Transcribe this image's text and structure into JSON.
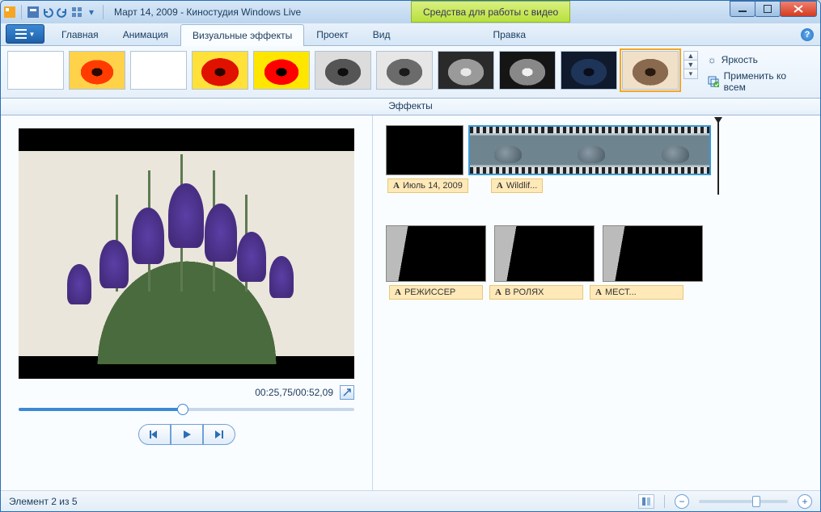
{
  "titlebar": {
    "title": "Март 14, 2009 - Киностудия Windows Live",
    "context_tab": "Средства для работы с видео"
  },
  "tabs": {
    "home": "Главная",
    "animation": "Анимация",
    "effects": "Визуальные эффекты",
    "project": "Проект",
    "view": "Вид",
    "edit": "Правка"
  },
  "ribbon": {
    "brightness": "Яркость",
    "apply_all": "Применить ко всем",
    "group_label": "Эффекты"
  },
  "preview": {
    "time": "00:25,75/00:52,09"
  },
  "timeline": {
    "caption1": "Июль 14, 2009",
    "caption2": "Wildlif...",
    "credit1": "РЕЖИССЕР",
    "credit2": "В РОЛЯХ",
    "credit3": "МЕСТ..."
  },
  "status": {
    "element_count": "Элемент 2 из 5"
  }
}
